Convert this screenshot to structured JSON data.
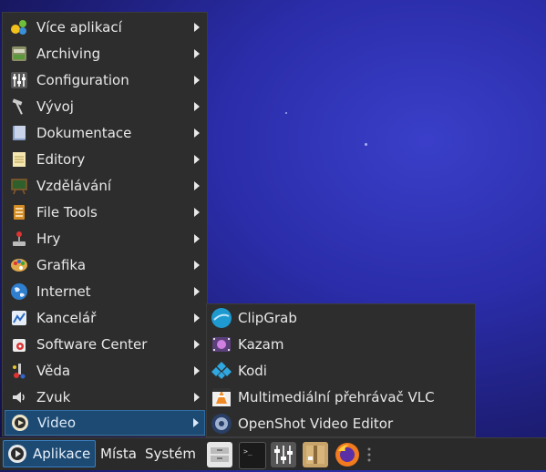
{
  "menu": {
    "items": [
      {
        "label": "Více aplikací",
        "icon": "more-apps-icon"
      },
      {
        "label": "Archiving",
        "icon": "archive-icon"
      },
      {
        "label": "Configuration",
        "icon": "sliders-icon"
      },
      {
        "label": "Vývoj",
        "icon": "hammer-icon"
      },
      {
        "label": "Dokumentace",
        "icon": "book-icon"
      },
      {
        "label": "Editory",
        "icon": "notepad-icon"
      },
      {
        "label": "Vzdělávání",
        "icon": "blackboard-icon"
      },
      {
        "label": "File Tools",
        "icon": "file-tools-icon"
      },
      {
        "label": "Hry",
        "icon": "joystick-icon"
      },
      {
        "label": "Grafika",
        "icon": "palette-icon"
      },
      {
        "label": "Internet",
        "icon": "globe-icon"
      },
      {
        "label": "Kancelář",
        "icon": "office-icon"
      },
      {
        "label": "Software Center",
        "icon": "software-center-icon"
      },
      {
        "label": "Věda",
        "icon": "science-icon"
      },
      {
        "label": "Zvuk",
        "icon": "speaker-icon"
      },
      {
        "label": "Video",
        "icon": "video-icon"
      }
    ]
  },
  "submenu": {
    "items": [
      {
        "label": "ClipGrab",
        "icon": "clipgrab-icon"
      },
      {
        "label": "Kazam",
        "icon": "kazam-icon"
      },
      {
        "label": "Kodi",
        "icon": "kodi-icon"
      },
      {
        "label": "Multimediální přehrávač VLC",
        "icon": "vlc-icon"
      },
      {
        "label": "OpenShot Video Editor",
        "icon": "openshot-icon"
      }
    ]
  },
  "taskbar": {
    "apps_label": "Aplikace",
    "places_label": "Místa",
    "system_label": "Systém"
  }
}
